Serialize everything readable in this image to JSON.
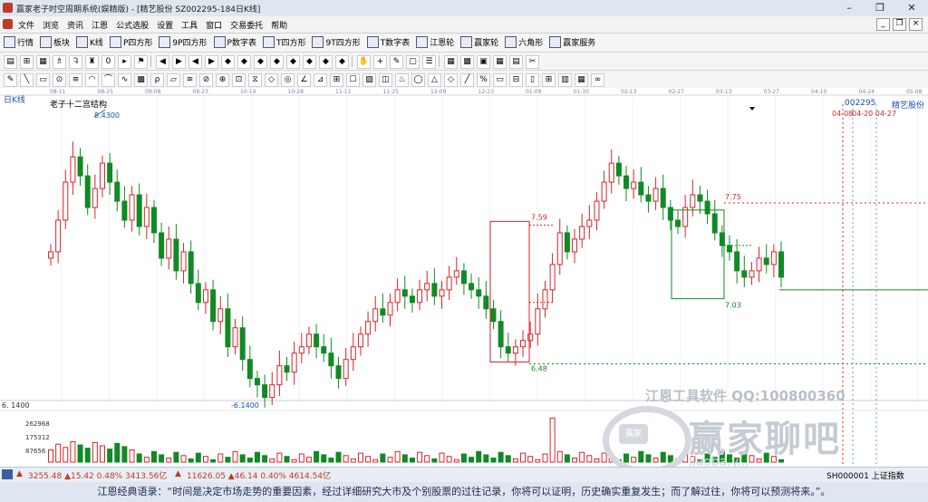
{
  "window": {
    "title": "赢家老子时空周期系统(娱精版) - [精艺股份  SZ002295-184日K线]",
    "minimize": "–",
    "restore": "❐",
    "close": "✕"
  },
  "menu": {
    "items": [
      "文件",
      "浏览",
      "资讯",
      "江恩",
      "公式选股",
      "设置",
      "工具",
      "窗口",
      "交易委托",
      "帮助"
    ],
    "mdi": [
      "_",
      "❐",
      "×"
    ]
  },
  "toolbar1": {
    "items": [
      {
        "icon": "grid",
        "label": "行情"
      },
      {
        "icon": "blocks",
        "label": "板块"
      },
      {
        "icon": "candles",
        "label": "K线"
      },
      {
        "icon": "P",
        "label": "P四方形"
      },
      {
        "icon": "9P",
        "label": "9P四方形"
      },
      {
        "icon": "P",
        "label": "P数字表"
      },
      {
        "icon": "T",
        "label": "T四方形"
      },
      {
        "icon": "9T",
        "label": "9T四方形"
      },
      {
        "icon": "T",
        "label": "T数字表"
      },
      {
        "icon": "wheel",
        "label": "江恩轮"
      },
      {
        "icon": "wheel",
        "label": "赢家轮"
      },
      {
        "icon": "hexagon",
        "label": "六角形"
      },
      {
        "icon": "service",
        "label": "赢家服务"
      }
    ]
  },
  "toolbar2": {
    "buttons": [
      "▤",
      "⊞",
      "▦",
      "♗",
      "Ꮈ",
      "♜",
      "0",
      "▸",
      "⚑",
      "|",
      "◀",
      "▶",
      "◀",
      "▶",
      "◆",
      "◆",
      "◆",
      "◆",
      "◆",
      "◆",
      "◆",
      "◆",
      "|",
      "✋",
      "+",
      "✎",
      "▢",
      "☰",
      "|",
      "▦",
      "▩",
      "▣",
      "▦",
      "▤",
      "✂"
    ]
  },
  "toolbar3": {
    "buttons": [
      "✎",
      "╲",
      "▭",
      "⊙",
      "≡",
      "◠",
      "⌒",
      "∿",
      "▩",
      "ρ",
      "▱",
      "≋",
      "⊘",
      "⊕",
      "⊡",
      "⧖",
      "◇",
      "◎",
      "∠",
      "⊿",
      "⊞",
      "☐",
      "▨",
      "◫",
      "♨",
      "◯",
      "△",
      "◇",
      "╱",
      "%",
      "▭",
      "⊟",
      "▯",
      "⊞",
      "▥",
      "▦",
      "∞"
    ]
  },
  "chart": {
    "timeframe": "日K线",
    "indicator": "老子十二宫结构",
    "code": "002295",
    "name": "精艺股份",
    "date_ticks": [
      "08-11",
      "08-25",
      "09-08",
      "09-23",
      "10-14",
      "10-28",
      "11-11",
      "11-25",
      "12-09",
      "12-23",
      "01-09",
      "01-30",
      "02-13",
      "02-27",
      "03-13",
      "03-27",
      "04-10",
      "04-24",
      "05-08"
    ],
    "high_label": "8.4300",
    "low_label": "6.1400",
    "price_axis_low": "6. 1400",
    "vol_axis": [
      "262968",
      "175312",
      "87656"
    ],
    "box1_top": "7.59",
    "box1_bottom": "6.48",
    "box2_top": "7.75",
    "box2_bottom": "7.03",
    "future_label": "04-08",
    "future_label2": "04-20 04-27",
    "colors": {
      "up": "#d9232a",
      "down": "#108a24",
      "grid": "#e4e4e4",
      "box_red": "#d9232a",
      "box_green": "#108a24"
    }
  },
  "watermark": {
    "line1": "江恩工具软件  QQ:100800360",
    "line2": "赢家聊吧",
    "domain": "liaoba.y...",
    "logo": "赢家"
  },
  "status": {
    "sh": "3255.48 ▲15.42 0.48% 3413.56亿",
    "sz": "11626.05 ▲46.14 0.40% 4614.54亿",
    "index": "SH000001 上证指数"
  },
  "quote": "江恩经典语录：“时间是决定市场走势的重要因素，经过详细研究大市及个别股票的过往记录，你将可以证明，历史确实重复发生；而了解过往，你将可以预测将来。”。"
}
